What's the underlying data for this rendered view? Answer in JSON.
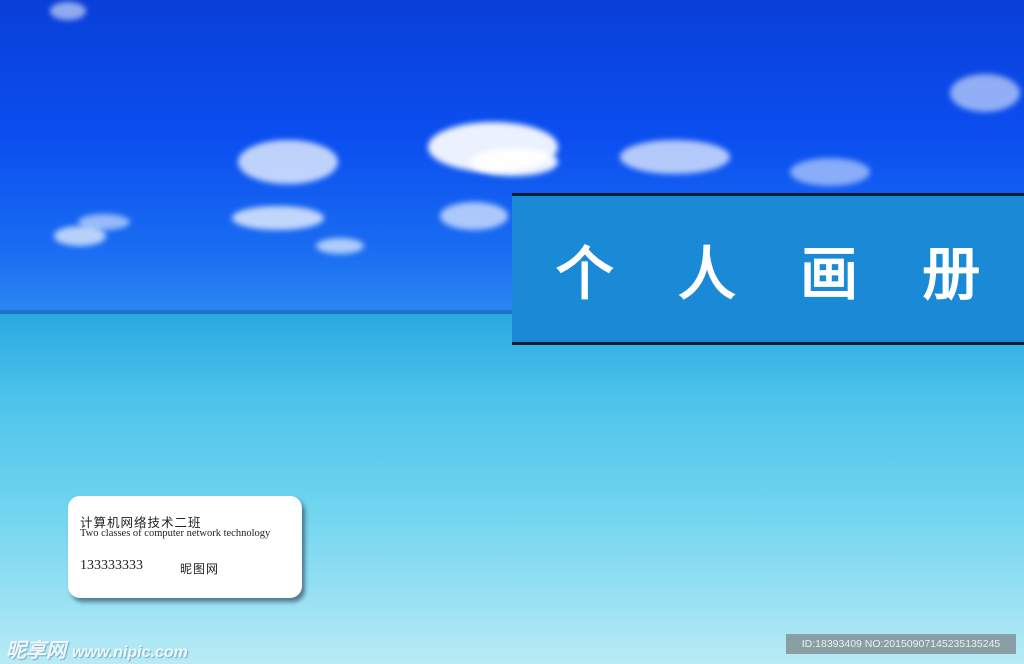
{
  "cover": {
    "title": "个 人 画 册",
    "card": {
      "class_name_cn": "计算机网络技术二班",
      "class_name_en": "Two classes of computer network technology",
      "phone": "133333333",
      "name": "昵图网"
    },
    "watermark": {
      "brand": "昵享网",
      "url": "www.nipic.com",
      "id_text": "ID:18393409 NO:20150907145235135245"
    }
  },
  "colors": {
    "title_band": "#1a8ad6",
    "sky": "#0b4ff0",
    "sea": "#6fd4ef"
  }
}
